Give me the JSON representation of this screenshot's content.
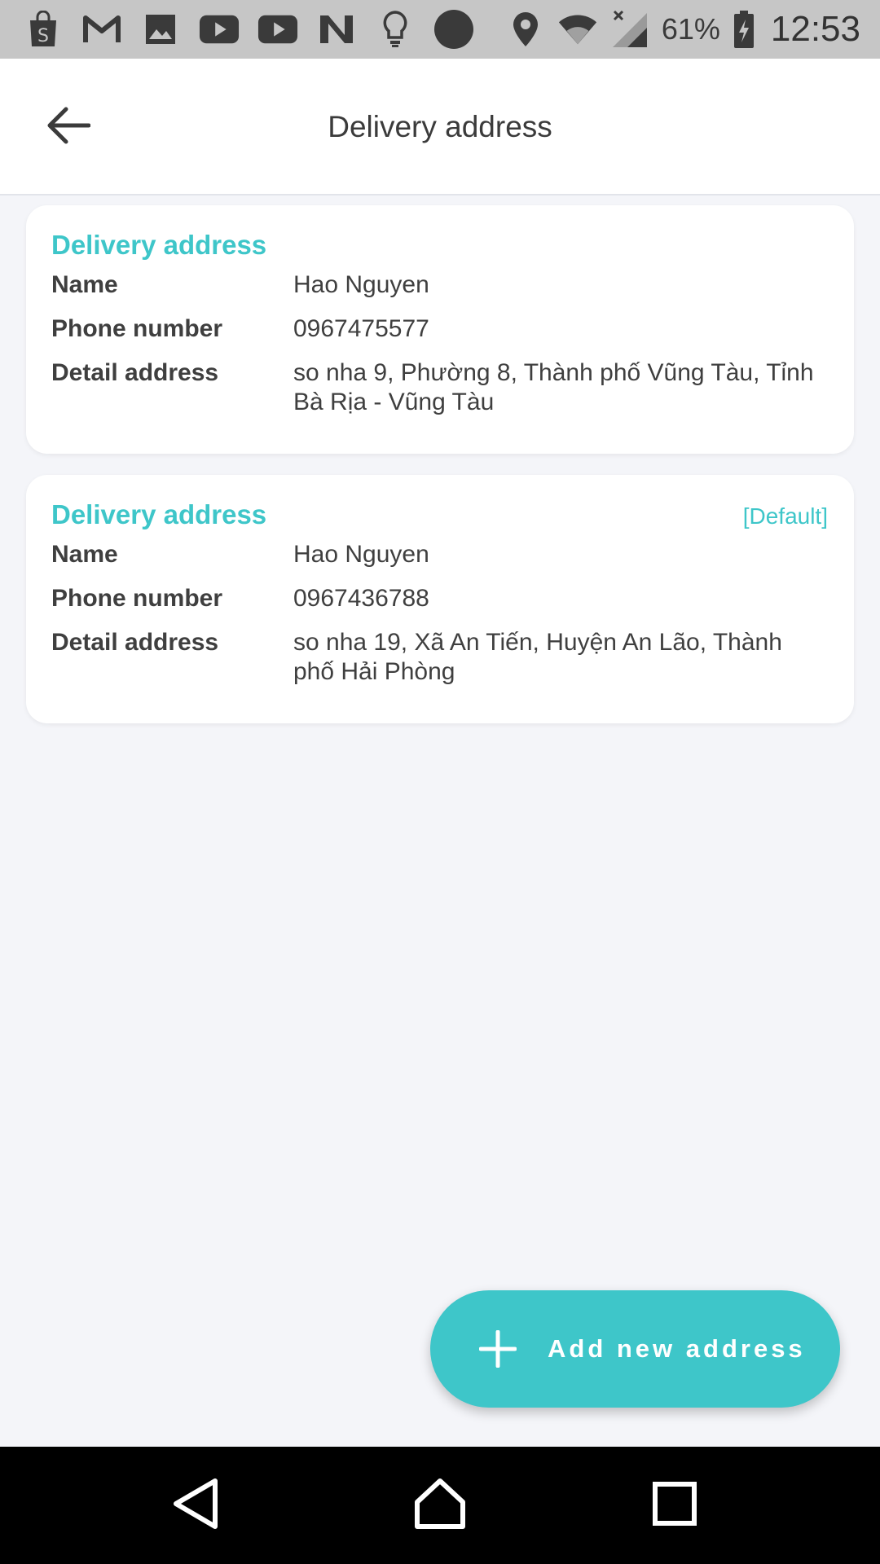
{
  "status_bar": {
    "battery_percent": "61%",
    "time": "12:53",
    "left_icons": [
      "shopping-bag-icon",
      "gmail-icon",
      "gallery-icon",
      "youtube-icon",
      "youtube-icon",
      "n-app-icon",
      "lightbulb-icon",
      "circle-icon"
    ],
    "right_icons": [
      "location-icon",
      "wifi-icon",
      "signal-icon",
      "battery-icon"
    ]
  },
  "app_bar": {
    "title": "Delivery address",
    "back_icon": "arrow-left-icon"
  },
  "labels": {
    "name": "Name",
    "phone": "Phone number",
    "detail": "Detail address"
  },
  "addresses": [
    {
      "title": "Delivery address",
      "default_label": "",
      "name": "Hao Nguyen",
      "phone": "0967475577",
      "detail": "so nha 9, Phường 8, Thành phố Vũng Tàu, Tỉnh Bà Rịa - Vũng Tàu"
    },
    {
      "title": "Delivery address",
      "default_label": "[Default]",
      "name": "Hao Nguyen",
      "phone": "0967436788",
      "detail": "so nha 19, Xã An Tiến, Huyện An Lão, Thành phố Hải Phòng"
    }
  ],
  "fab": {
    "label": "Add new address",
    "icon": "plus-icon"
  },
  "nav_bar": {
    "icons": [
      "back-triangle-icon",
      "home-icon",
      "recents-icon"
    ]
  },
  "colors": {
    "accent": "#3ec6c9",
    "background": "#f4f5f9",
    "status_bar": "#c6c6c6",
    "text": "#3f3f3f"
  }
}
